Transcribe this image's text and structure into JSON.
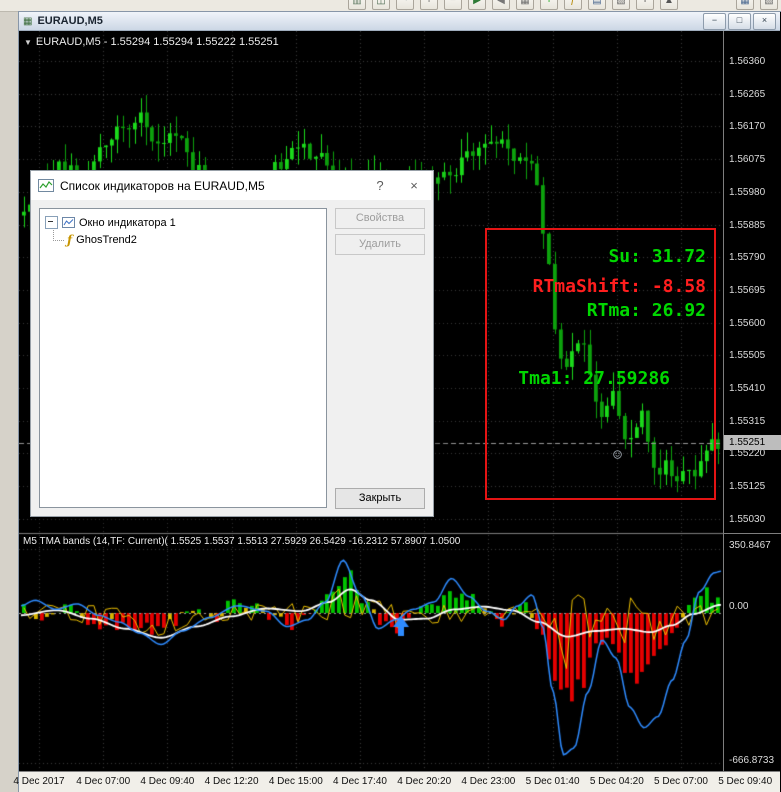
{
  "window": {
    "title": "EURAUD,M5",
    "icon_glyph": "▦",
    "header_marker": "▼",
    "controls": {
      "minimize": "−",
      "restore": "□",
      "close": "×"
    },
    "toolbar_icons": [
      {
        "name": "ohlc-bars-icon",
        "glyph": "▥",
        "color": "#5f7a63"
      },
      {
        "name": "candlestick-icon",
        "glyph": "◫",
        "color": "#4d6b52"
      },
      {
        "name": "line-chart-icon",
        "glyph": "~",
        "color": "#4f6b66"
      },
      {
        "name": "zoom-in-icon",
        "glyph": "+",
        "color": "#585858"
      },
      {
        "name": "zoom-out-icon",
        "glyph": "−",
        "color": "#585858"
      },
      {
        "name": "auto-scroll-icon",
        "glyph": "▶",
        "color": "#2d7a35"
      },
      {
        "name": "chart-shift-icon",
        "glyph": "◀",
        "color": "#777777"
      },
      {
        "name": "grid-icon",
        "glyph": "▦",
        "color": "#6d6d6d"
      },
      {
        "name": "new-order-icon",
        "glyph": "+",
        "color": "#00a000"
      },
      {
        "name": "indicators-icon",
        "glyph": "ƒ",
        "color": "#b38600"
      },
      {
        "name": "periods-icon",
        "glyph": "▤",
        "color": "#49678f"
      },
      {
        "name": "templates-icon",
        "glyph": "▧",
        "color": "#6d6d6d"
      },
      {
        "name": "crosshair-icon",
        "glyph": "+",
        "color": "#3a3a3a"
      },
      {
        "name": "cursor-icon",
        "glyph": "▲",
        "color": "#555555"
      }
    ],
    "toolbar_icons_right": [
      {
        "name": "tile-windows-icon",
        "glyph": "▦",
        "color": "#49678f"
      },
      {
        "name": "cascade-windows-icon",
        "glyph": "▧",
        "color": "#6d6d6d"
      }
    ]
  },
  "chart": {
    "header": "EURAUD,M5 - 1.55294 1.55294 1.55222 1.55251",
    "indicator_header": "M5 TMA bands (14,TF: Current)( 1.5525 1.5537 1.5513 27.5929 26.5429 -16.2312 57.8907 1.0500",
    "current_price": "1.55251"
  },
  "annotation": {
    "su": "Su: 31.72",
    "rtma_shift": "RTmaShift: -8.58",
    "rtma": "RTma: 26.92",
    "tma1": "Tma1: 27.59286",
    "smiley": "☺",
    "colors": {
      "positive": "#00d800",
      "negative": "#ff1e1e",
      "box": "#e41414"
    }
  },
  "dialog": {
    "title": "Список индикаторов на EURAUD,M5",
    "help_label": "?",
    "close_label": "×",
    "tree": {
      "root": "Окно индикатора 1",
      "child": "GhosTrend2",
      "child_icon": "ƒ"
    },
    "buttons": {
      "properties": "Свойства",
      "delete": "Удалить",
      "close": "Закрыть"
    }
  },
  "chart_data": {
    "type": "candlestick",
    "symbol": "EURAUD",
    "timeframe": "M5",
    "ohlc": {
      "open": 1.55294,
      "high": 1.55294,
      "low": 1.55222,
      "close": 1.55251
    },
    "price_axis": {
      "labels": [
        "1.56360",
        "1.56265",
        "1.56170",
        "1.56075",
        "1.55980",
        "1.55885",
        "1.55790",
        "1.55695",
        "1.55600",
        "1.55505",
        "1.55410",
        "1.55315",
        "1.55220",
        "1.55125",
        "1.55030"
      ],
      "current": 1.55251
    },
    "time_axis": {
      "labels": [
        "4 Dec 2017",
        "4 Dec 07:00",
        "4 Dec 09:40",
        "4 Dec 12:20",
        "4 Dec 15:00",
        "4 Dec 17:40",
        "4 Dec 20:20",
        "4 Dec 23:00",
        "5 Dec 01:40",
        "5 Dec 04:20",
        "5 Dec 07:00",
        "5 Dec 09:40"
      ]
    },
    "indicator_axis": {
      "labels": [
        "350.8467",
        "0.00",
        "-666.8733"
      ],
      "max": 350.8467,
      "min": -666.8733
    },
    "candles": {
      "count": 120,
      "close_keys": [
        [
          0,
          1.5594
        ],
        [
          0.03,
          1.5601
        ],
        [
          0.06,
          1.5606
        ],
        [
          0.085,
          1.5599
        ],
        [
          0.11,
          1.561
        ],
        [
          0.145,
          1.5617
        ],
        [
          0.165,
          1.562
        ],
        [
          0.19,
          1.561
        ],
        [
          0.215,
          1.5616
        ],
        [
          0.245,
          1.5605
        ],
        [
          0.275,
          1.5596
        ],
        [
          0.305,
          1.5591
        ],
        [
          0.335,
          1.5599
        ],
        [
          0.365,
          1.5606
        ],
        [
          0.39,
          1.5612
        ],
        [
          0.42,
          1.5609
        ],
        [
          0.45,
          1.5603
        ],
        [
          0.48,
          1.56
        ],
        [
          0.51,
          1.5604
        ],
        [
          0.54,
          1.56
        ],
        [
          0.565,
          1.5602
        ],
        [
          0.59,
          1.56
        ],
        [
          0.615,
          1.5604
        ],
        [
          0.64,
          1.5608
        ],
        [
          0.665,
          1.5611
        ],
        [
          0.69,
          1.5611
        ],
        [
          0.715,
          1.5608
        ],
        [
          0.735,
          1.5605
        ],
        [
          0.75,
          1.5586
        ],
        [
          0.765,
          1.556
        ],
        [
          0.775,
          1.5546
        ],
        [
          0.79,
          1.5551
        ],
        [
          0.805,
          1.5553
        ],
        [
          0.82,
          1.554
        ],
        [
          0.835,
          1.5532
        ],
        [
          0.848,
          1.5542
        ],
        [
          0.862,
          1.5529
        ],
        [
          0.875,
          1.5525
        ],
        [
          0.888,
          1.5533
        ],
        [
          0.9,
          1.5527
        ],
        [
          0.912,
          1.5516
        ],
        [
          0.925,
          1.5522
        ],
        [
          0.938,
          1.5513
        ],
        [
          0.95,
          1.5519
        ],
        [
          0.962,
          1.5514
        ],
        [
          0.974,
          1.5521
        ],
        [
          0.987,
          1.5526
        ],
        [
          1,
          1.55251
        ]
      ]
    },
    "indicator": {
      "name": "TMA bands",
      "values": [
        27.5929,
        26.5429,
        -16.2312,
        57.8907,
        1.05
      ],
      "blue_keys": [
        [
          0,
          40
        ],
        [
          0.02,
          70
        ],
        [
          0.05,
          20
        ],
        [
          0.08,
          50
        ],
        [
          0.11,
          -10
        ],
        [
          0.14,
          -40
        ],
        [
          0.17,
          -90
        ],
        [
          0.2,
          -140
        ],
        [
          0.23,
          -80
        ],
        [
          0.27,
          -20
        ],
        [
          0.31,
          40
        ],
        [
          0.35,
          10
        ],
        [
          0.38,
          -60
        ],
        [
          0.41,
          -30
        ],
        [
          0.435,
          60
        ],
        [
          0.46,
          290
        ],
        [
          0.485,
          100
        ],
        [
          0.51,
          -70
        ],
        [
          0.535,
          -30
        ],
        [
          0.56,
          20
        ],
        [
          0.59,
          60
        ],
        [
          0.615,
          190
        ],
        [
          0.64,
          90
        ],
        [
          0.665,
          10
        ],
        [
          0.69,
          -30
        ],
        [
          0.71,
          40
        ],
        [
          0.73,
          100
        ],
        [
          0.745,
          -60
        ],
        [
          0.76,
          -350
        ],
        [
          0.775,
          -630
        ],
        [
          0.79,
          -600
        ],
        [
          0.81,
          -350
        ],
        [
          0.83,
          -120
        ],
        [
          0.85,
          -200
        ],
        [
          0.87,
          -420
        ],
        [
          0.89,
          -510
        ],
        [
          0.91,
          -460
        ],
        [
          0.93,
          -300
        ],
        [
          0.95,
          -120
        ],
        [
          0.97,
          120
        ],
        [
          0.99,
          220
        ],
        [
          1,
          230
        ]
      ],
      "white_keys": [
        [
          0,
          -10
        ],
        [
          0.05,
          15
        ],
        [
          0.1,
          -25
        ],
        [
          0.15,
          -70
        ],
        [
          0.2,
          -110
        ],
        [
          0.25,
          -60
        ],
        [
          0.3,
          -15
        ],
        [
          0.35,
          25
        ],
        [
          0.4,
          10
        ],
        [
          0.44,
          60
        ],
        [
          0.47,
          130
        ],
        [
          0.5,
          70
        ],
        [
          0.54,
          -30
        ],
        [
          0.58,
          -25
        ],
        [
          0.62,
          20
        ],
        [
          0.66,
          35
        ],
        [
          0.7,
          15
        ],
        [
          0.74,
          -40
        ],
        [
          0.78,
          -105
        ],
        [
          0.82,
          -80
        ],
        [
          0.86,
          -70
        ],
        [
          0.9,
          -85
        ],
        [
          0.93,
          -55
        ],
        [
          0.96,
          -5
        ],
        [
          1,
          45
        ]
      ],
      "hist_keys": [
        [
          0,
          30
        ],
        [
          0.03,
          -40
        ],
        [
          0.06,
          50
        ],
        [
          0.09,
          -60
        ],
        [
          0.12,
          -80
        ],
        [
          0.15,
          -70
        ],
        [
          0.18,
          -90
        ],
        [
          0.21,
          -60
        ],
        [
          0.24,
          40
        ],
        [
          0.27,
          -50
        ],
        [
          0.3,
          60
        ],
        [
          0.33,
          50
        ],
        [
          0.36,
          -40
        ],
        [
          0.39,
          -60
        ],
        [
          0.42,
          40
        ],
        [
          0.445,
          120
        ],
        [
          0.465,
          290
        ],
        [
          0.49,
          80
        ],
        [
          0.52,
          -90
        ],
        [
          0.55,
          -60
        ],
        [
          0.58,
          40
        ],
        [
          0.61,
          130
        ],
        [
          0.635,
          110
        ],
        [
          0.66,
          50
        ],
        [
          0.69,
          -40
        ],
        [
          0.72,
          60
        ],
        [
          0.74,
          -80
        ],
        [
          0.76,
          -300
        ],
        [
          0.78,
          -480
        ],
        [
          0.8,
          -380
        ],
        [
          0.82,
          -200
        ],
        [
          0.84,
          -150
        ],
        [
          0.86,
          -280
        ],
        [
          0.88,
          -320
        ],
        [
          0.9,
          -260
        ],
        [
          0.92,
          -180
        ],
        [
          0.94,
          -100
        ],
        [
          0.96,
          80
        ],
        [
          0.98,
          130
        ],
        [
          1,
          100
        ]
      ]
    },
    "colors": {
      "bull": "#1bdb1b",
      "bear": "#0da10d",
      "hist_up": "#00c400",
      "hist_down": "#e60000",
      "hist_small": "#d8b400",
      "band": "#2e8bff",
      "center": "#ffffff",
      "signal": "#edc000",
      "grid": "#3c3c3c"
    }
  }
}
